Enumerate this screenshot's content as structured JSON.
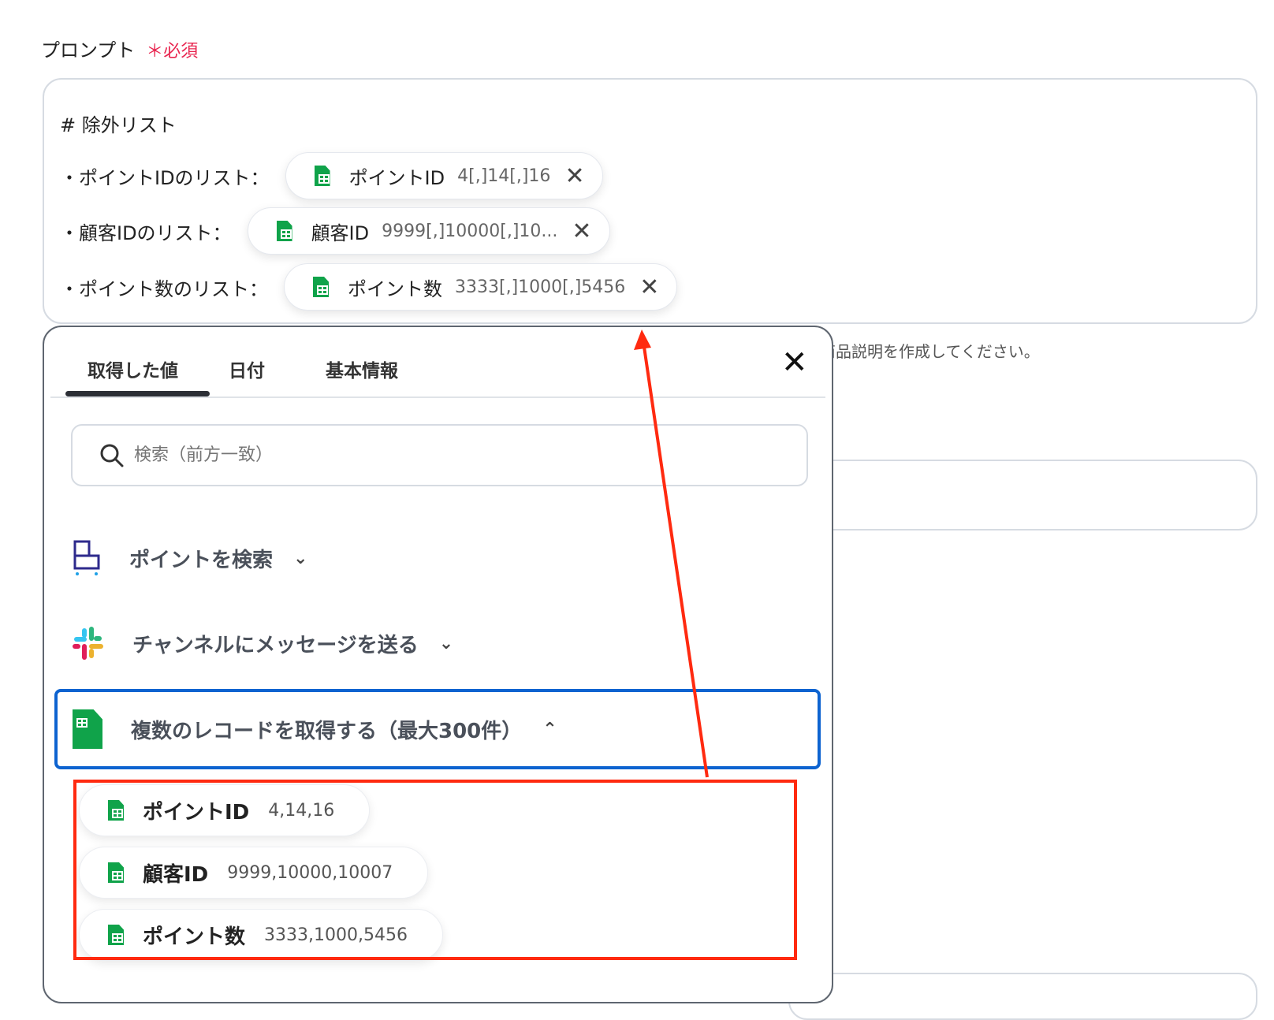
{
  "field": {
    "label": "プロンプト",
    "required": "＊必須"
  },
  "prompt": {
    "heading": "# 除外リスト",
    "lines": [
      {
        "prefix": "・ポイントIDのリスト：",
        "chip_name": "ポイントID",
        "chip_value": "4[,]14[,]16",
        "remove": "✕"
      },
      {
        "prefix": "・顧客IDのリスト：",
        "chip_name": "顧客ID",
        "chip_value": "9999[,]10000[,]10...",
        "remove": "✕"
      },
      {
        "prefix": "・ポイント数のリスト：",
        "chip_name": "ポイント数",
        "chip_value": "3333[,]1000[,]5456",
        "remove": "✕"
      }
    ]
  },
  "helper_text": "商品説明を作成してください。",
  "panel": {
    "tabs": [
      "取得した値",
      "日付",
      "基本情報"
    ],
    "close": "✕",
    "search_placeholder": "検索（前方一致）",
    "items": [
      {
        "label": "ポイントを検索",
        "chevron": "⌄",
        "icon": "pos-register-icon"
      },
      {
        "label": "チャンネルにメッセージを送る",
        "chevron": "⌄",
        "icon": "slack-icon"
      },
      {
        "label": "複数のレコードを取得する（最大300件）",
        "chevron": "⌃",
        "icon": "google-sheets-icon"
      }
    ],
    "outputs": [
      {
        "name": "ポイントID",
        "value": "4,14,16"
      },
      {
        "name": "顧客ID",
        "value": "9999,10000,10007"
      },
      {
        "name": "ポイント数",
        "value": "3333,1000,5456"
      }
    ]
  },
  "colors": {
    "required": "#e8254f",
    "selected_border": "#0d63d0",
    "annotation": "#ff2a10",
    "sheets": "#10a34a"
  }
}
